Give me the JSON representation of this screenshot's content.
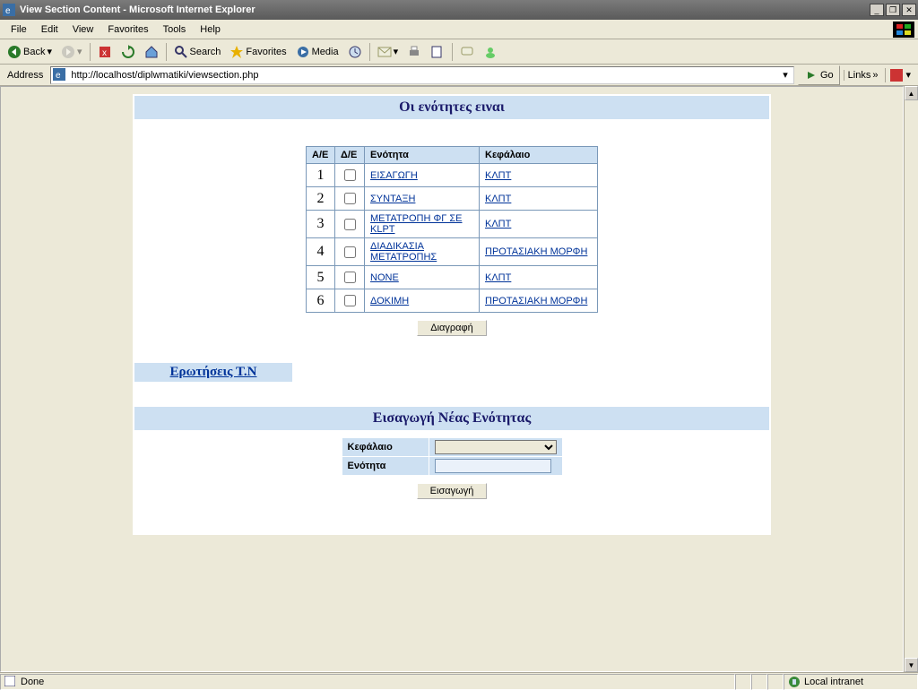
{
  "window": {
    "title": "View Section Content - Microsoft Internet Explorer"
  },
  "menu": {
    "file": "File",
    "edit": "Edit",
    "view": "View",
    "favorites": "Favorites",
    "tools": "Tools",
    "help": "Help"
  },
  "toolbar": {
    "back": "Back",
    "search": "Search",
    "favorites": "Favorites",
    "media": "Media"
  },
  "address": {
    "label": "Address",
    "url": "http://localhost/diplwmatiki/viewsection.php",
    "go": "Go",
    "links": "Links"
  },
  "page": {
    "banner1": "Οι ενότητες ειναι",
    "table": {
      "headers": {
        "aa": "Α/Ε",
        "de": "Δ/Ε",
        "enotita": "Ενότητα",
        "kefalaio": "Κεφάλαιο"
      },
      "rows": [
        {
          "n": "1",
          "enotita": "ΕΙΣΑΓΩΓΗ",
          "kefalaio": "ΚΛΠΤ"
        },
        {
          "n": "2",
          "enotita": "ΣΥΝΤΑΞΗ",
          "kefalaio": "ΚΛΠΤ"
        },
        {
          "n": "3",
          "enotita": "ΜΕΤΑΤΡΟΠΗ ΦΓ ΣΕ KLPT",
          "kefalaio": "ΚΛΠΤ"
        },
        {
          "n": "4",
          "enotita": "ΔΙΑΔΙΚΑΣΙΑ ΜΕΤΑΤΡΟΠΗΣ",
          "kefalaio": "ΠΡΟΤΑΣΙΑΚΗ ΜΟΡΦΗ"
        },
        {
          "n": "5",
          "enotita": "NONE",
          "kefalaio": "ΚΛΠΤ"
        },
        {
          "n": "6",
          "enotita": "ΔΟΚΙΜΗ",
          "kefalaio": "ΠΡΟΤΑΣΙΑΚΗ ΜΟΡΦΗ"
        }
      ]
    },
    "delete_btn": "Διαγραφή",
    "questions_link": "Ερωτήσεις Τ.Ν",
    "banner2": "Εισαγωγή Νέας Ενότητας",
    "form": {
      "kefalaio": "Κεφάλαιο",
      "enotita": "Ενότητα"
    },
    "insert_btn": "Εισαγωγή"
  },
  "status": {
    "done": "Done",
    "zone": "Local intranet"
  }
}
